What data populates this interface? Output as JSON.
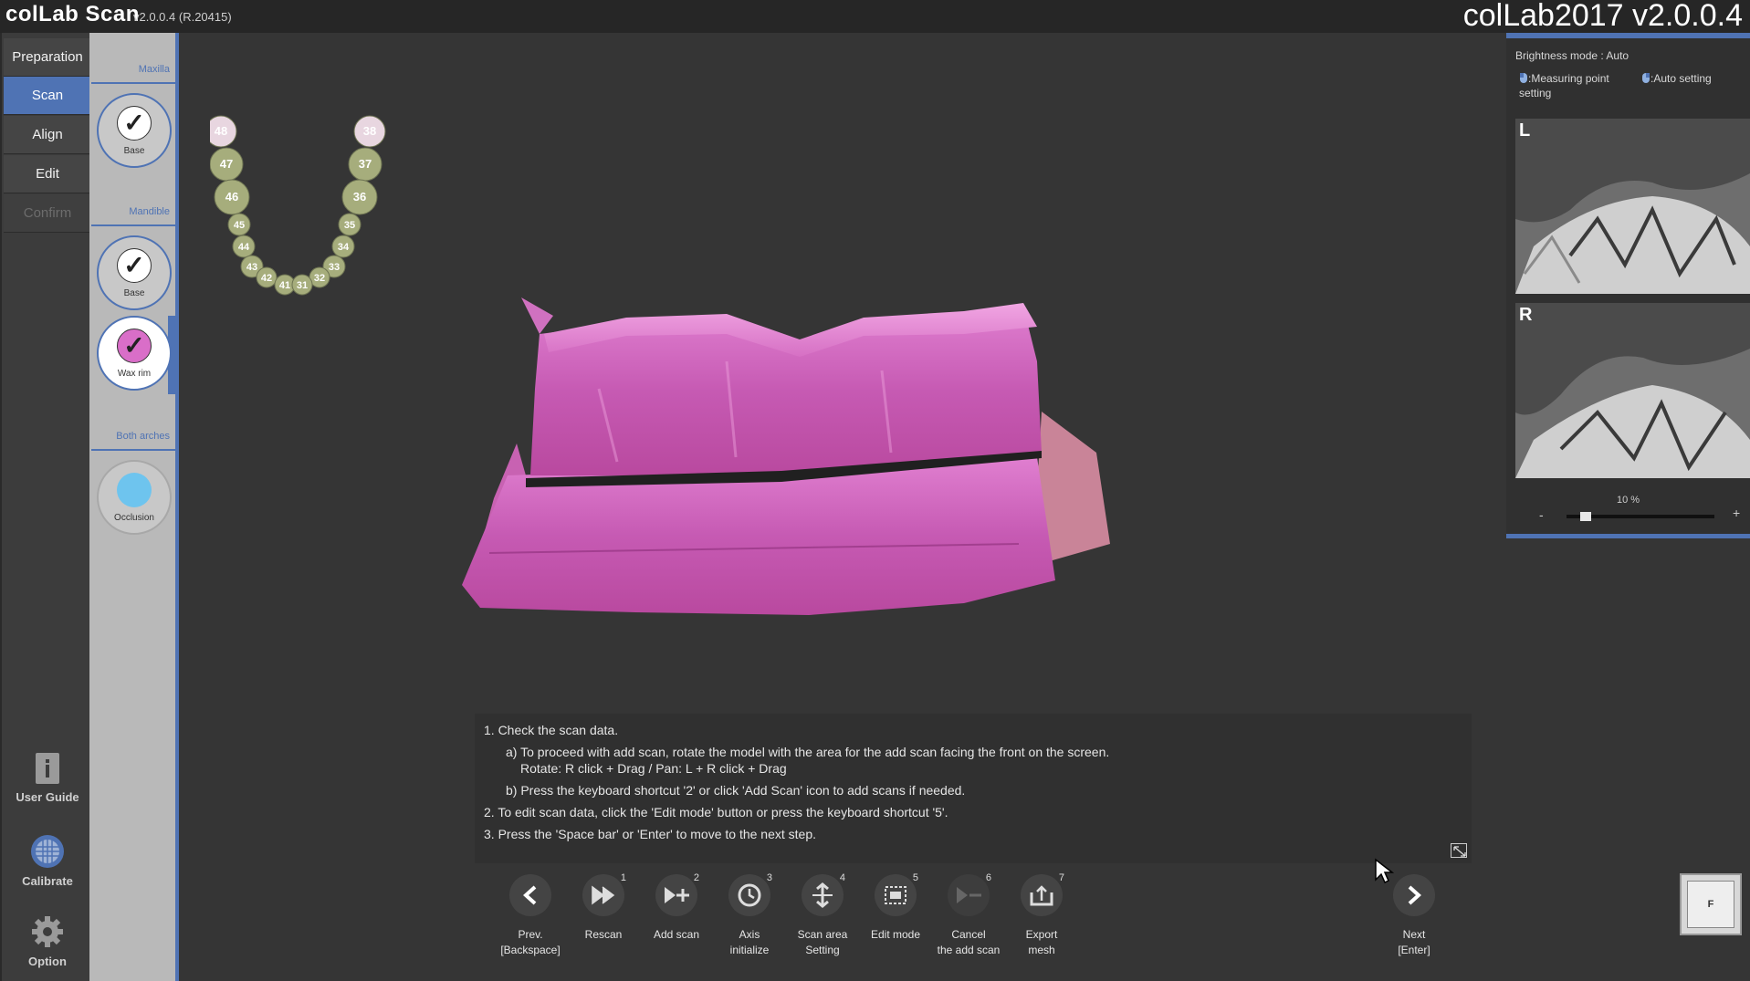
{
  "titlebar": {
    "app_name": "colLab Scan",
    "version": "v2.0.0.4  (R.20415)",
    "watermark": "colLab2017 v2.0.0.4"
  },
  "nav": {
    "items": [
      {
        "label": "Preparation",
        "state": "normal"
      },
      {
        "label": "Scan",
        "state": "active"
      },
      {
        "label": "Align",
        "state": "normal"
      },
      {
        "label": "Edit",
        "state": "normal"
      },
      {
        "label": "Confirm",
        "state": "disabled"
      }
    ],
    "user_guide": "User Guide",
    "calibrate": "Calibrate",
    "option": "Option"
  },
  "steps": {
    "maxilla_label": "Maxilla",
    "mandible_label": "Mandible",
    "both_label": "Both arches",
    "maxilla_base": "Base",
    "mandible_base": "Base",
    "wax_rim": "Wax rim",
    "occlusion": "Occlusion",
    "check_mark": "✓"
  },
  "teeth_chart": {
    "left": [
      "48",
      "47",
      "46",
      "45",
      "44",
      "43",
      "42",
      "41"
    ],
    "right": [
      "38",
      "37",
      "36",
      "35",
      "34",
      "33",
      "32",
      "31"
    ]
  },
  "brightness": {
    "title": "Brightness mode : Auto",
    "measuring_hint": ":Measuring point setting",
    "auto_hint": ":Auto setting",
    "left_view": "L",
    "right_view": "R",
    "zoom_label": "10 %",
    "zoom_minus": "-",
    "zoom_plus": "+",
    "zoom_value": 0.1
  },
  "instructions": {
    "line1": "1. Check the scan data.",
    "line1a": "a) To proceed with add scan, rotate the model with the area for the add scan facing the front on the screen.",
    "line1a2": "Rotate: R click + Drag / Pan: L + R click + Drag",
    "line1b": "b) Press the keyboard shortcut '2' or click 'Add Scan' icon to add scans if needed.",
    "line2": "2. To edit scan data, click the 'Edit mode' button or press the keyboard shortcut '5'.",
    "line3": "3. Press the 'Space bar' or 'Enter' to move to the next step."
  },
  "toolbar": {
    "prev": {
      "line1": "Prev.",
      "line2": "[Backspace]"
    },
    "rescan": {
      "num": "1",
      "label": "Rescan"
    },
    "add_scan": {
      "num": "2",
      "label": "Add scan"
    },
    "axis": {
      "num": "3",
      "line1": "Axis",
      "line2": "initialize"
    },
    "scan_area": {
      "num": "4",
      "line1": "Scan area",
      "line2": "Setting"
    },
    "edit_mode": {
      "num": "5",
      "label": "Edit mode"
    },
    "cancel_add": {
      "num": "6",
      "line1": "Cancel",
      "line2": "the add scan"
    },
    "export": {
      "num": "7",
      "line1": "Export",
      "line2": "mesh"
    },
    "next": {
      "line1": "Next",
      "line2": "[Enter]"
    }
  },
  "view_cube": {
    "face": "F"
  },
  "colors": {
    "accent": "#4f73b4",
    "model": "#d96ec8",
    "tooth": "#a6ad7c",
    "tooth_edge": "#e8d6e0",
    "occlusion": "#6ec4ee"
  }
}
